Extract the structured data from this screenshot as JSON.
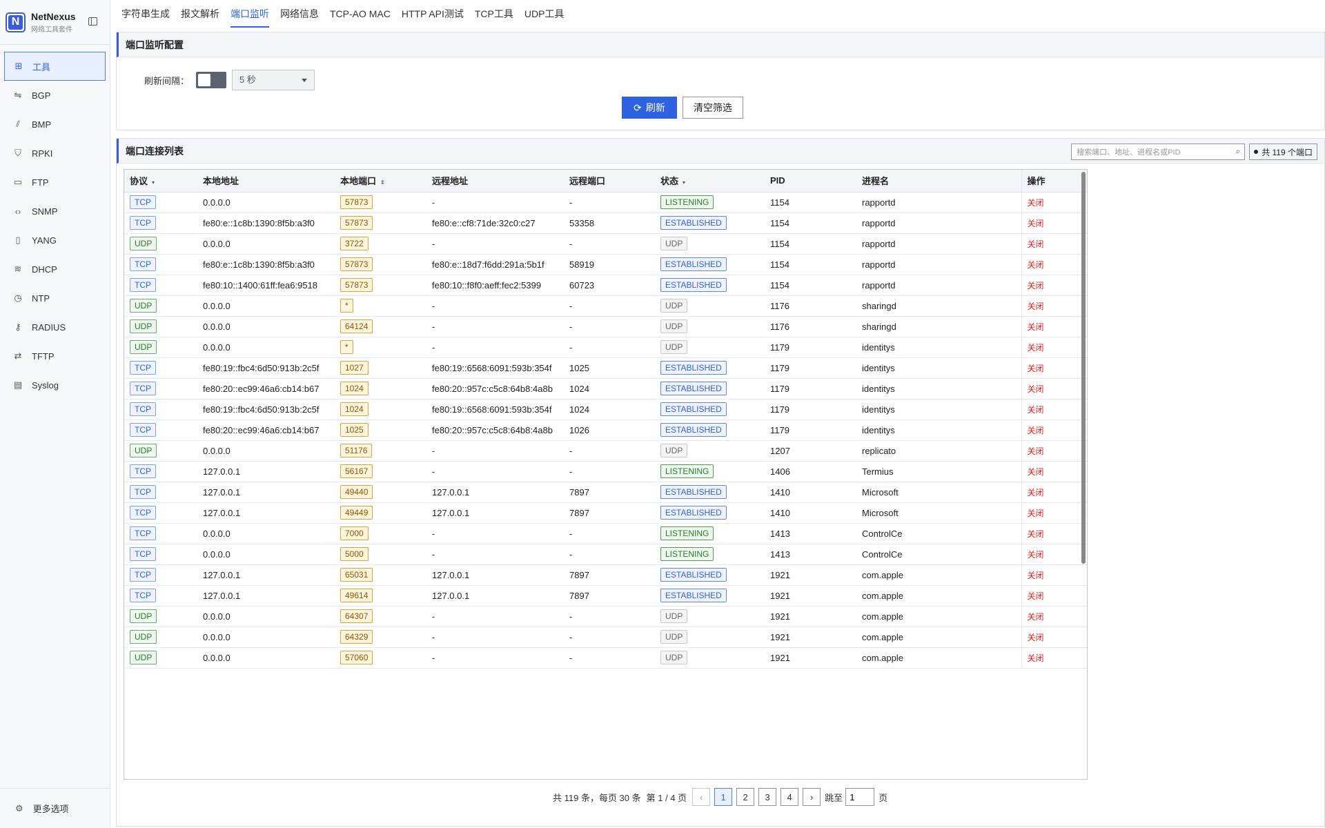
{
  "brand": {
    "name": "NetNexus",
    "subtitle": "网络工具套件",
    "logo_letter": "N"
  },
  "sidebar": {
    "items": [
      {
        "label": "工具",
        "icon": "grid-icon",
        "glyph": "⊞",
        "active": true
      },
      {
        "label": "BGP",
        "icon": "routes-icon",
        "glyph": "⇋"
      },
      {
        "label": "BMP",
        "icon": "chart-icon",
        "glyph": "⫽"
      },
      {
        "label": "RPKI",
        "icon": "shield-icon",
        "glyph": "⛉"
      },
      {
        "label": "FTP",
        "icon": "folder-icon",
        "glyph": "▭"
      },
      {
        "label": "SNMP",
        "icon": "code-icon",
        "glyph": "‹›"
      },
      {
        "label": "YANG",
        "icon": "file-icon",
        "glyph": "▯"
      },
      {
        "label": "DHCP",
        "icon": "wifi-icon",
        "glyph": "≋"
      },
      {
        "label": "NTP",
        "icon": "clock-icon",
        "glyph": "◷"
      },
      {
        "label": "RADIUS",
        "icon": "key-icon",
        "glyph": "⚷"
      },
      {
        "label": "TFTP",
        "icon": "swap-icon",
        "glyph": "⇄"
      },
      {
        "label": "Syslog",
        "icon": "document-icon",
        "glyph": "▤"
      }
    ],
    "footer": {
      "label": "更多选项",
      "glyph": "⚙"
    }
  },
  "tabs": [
    "字符串生成",
    "报文解析",
    "端口监听",
    "网络信息",
    "TCP-AO MAC",
    "HTTP API测试",
    "TCP工具",
    "UDP工具"
  ],
  "active_tab": 2,
  "config": {
    "title": "端口监听配置",
    "interval_label": "刷新间隔：",
    "interval_value": "5 秒",
    "refresh_label": "刷新",
    "clear_label": "清空筛选"
  },
  "list": {
    "title": "端口连接列表",
    "search_placeholder": "搜索端口、地址、进程名或PID",
    "count_label": "共 119 个端口",
    "columns": [
      "协议",
      "本地地址",
      "本地端口",
      "远程地址",
      "远程端口",
      "状态",
      "PID",
      "进程名",
      "操作"
    ],
    "close_label": "关闭",
    "rows": [
      [
        "TCP",
        "0.0.0.0",
        "57873",
        "-",
        "-",
        "LISTENING",
        "1154",
        "rapportd"
      ],
      [
        "TCP",
        "fe80:e::1c8b:1390:8f5b:a3f0",
        "57873",
        "fe80:e::cf8:71de:32c0:c27",
        "53358",
        "ESTABLISHED",
        "1154",
        "rapportd"
      ],
      [
        "UDP",
        "0.0.0.0",
        "3722",
        "-",
        "-",
        "UDP",
        "1154",
        "rapportd"
      ],
      [
        "TCP",
        "fe80:e::1c8b:1390:8f5b:a3f0",
        "57873",
        "fe80:e::18d7:f6dd:291a:5b1f",
        "58919",
        "ESTABLISHED",
        "1154",
        "rapportd"
      ],
      [
        "TCP",
        "fe80:10::1400:61ff:fea6:9518",
        "57873",
        "fe80:10::f8f0:aeff:fec2:5399",
        "60723",
        "ESTABLISHED",
        "1154",
        "rapportd"
      ],
      [
        "UDP",
        "0.0.0.0",
        "*",
        "-",
        "-",
        "UDP",
        "1176",
        "sharingd"
      ],
      [
        "UDP",
        "0.0.0.0",
        "64124",
        "-",
        "-",
        "UDP",
        "1176",
        "sharingd"
      ],
      [
        "UDP",
        "0.0.0.0",
        "*",
        "-",
        "-",
        "UDP",
        "1179",
        "identitys"
      ],
      [
        "TCP",
        "fe80:19::fbc4:6d50:913b:2c5f",
        "1027",
        "fe80:19::6568:6091:593b:354f",
        "1025",
        "ESTABLISHED",
        "1179",
        "identitys"
      ],
      [
        "TCP",
        "fe80:20::ec99:46a6:cb14:b67",
        "1024",
        "fe80:20::957c:c5c8:64b8:4a8b",
        "1024",
        "ESTABLISHED",
        "1179",
        "identitys"
      ],
      [
        "TCP",
        "fe80:19::fbc4:6d50:913b:2c5f",
        "1024",
        "fe80:19::6568:6091:593b:354f",
        "1024",
        "ESTABLISHED",
        "1179",
        "identitys"
      ],
      [
        "TCP",
        "fe80:20::ec99:46a6:cb14:b67",
        "1025",
        "fe80:20::957c:c5c8:64b8:4a8b",
        "1026",
        "ESTABLISHED",
        "1179",
        "identitys"
      ],
      [
        "UDP",
        "0.0.0.0",
        "51176",
        "-",
        "-",
        "UDP",
        "1207",
        "replicato"
      ],
      [
        "TCP",
        "127.0.0.1",
        "56167",
        "-",
        "-",
        "LISTENING",
        "1406",
        "Termius"
      ],
      [
        "TCP",
        "127.0.0.1",
        "49440",
        "127.0.0.1",
        "7897",
        "ESTABLISHED",
        "1410",
        "Microsoft"
      ],
      [
        "TCP",
        "127.0.0.1",
        "49449",
        "127.0.0.1",
        "7897",
        "ESTABLISHED",
        "1410",
        "Microsoft"
      ],
      [
        "TCP",
        "0.0.0.0",
        "7000",
        "-",
        "-",
        "LISTENING",
        "1413",
        "ControlCe"
      ],
      [
        "TCP",
        "0.0.0.0",
        "5000",
        "-",
        "-",
        "LISTENING",
        "1413",
        "ControlCe"
      ],
      [
        "TCP",
        "127.0.0.1",
        "65031",
        "127.0.0.1",
        "7897",
        "ESTABLISHED",
        "1921",
        "com.apple"
      ],
      [
        "TCP",
        "127.0.0.1",
        "49614",
        "127.0.0.1",
        "7897",
        "ESTABLISHED",
        "1921",
        "com.apple"
      ],
      [
        "UDP",
        "0.0.0.0",
        "64307",
        "-",
        "-",
        "UDP",
        "1921",
        "com.apple"
      ],
      [
        "UDP",
        "0.0.0.0",
        "64329",
        "-",
        "-",
        "UDP",
        "1921",
        "com.apple"
      ],
      [
        "UDP",
        "0.0.0.0",
        "57060",
        "-",
        "-",
        "UDP",
        "1921",
        "com.apple"
      ]
    ]
  },
  "pager": {
    "summary": "共 119 条，每页 30 条",
    "page_info": "第 1 / 4 页",
    "prev": "‹",
    "next": "›",
    "pages": [
      "1",
      "2",
      "3",
      "4"
    ],
    "current": "1",
    "jump_label": "跳至",
    "jump_value": "1",
    "page_suffix": "页"
  }
}
